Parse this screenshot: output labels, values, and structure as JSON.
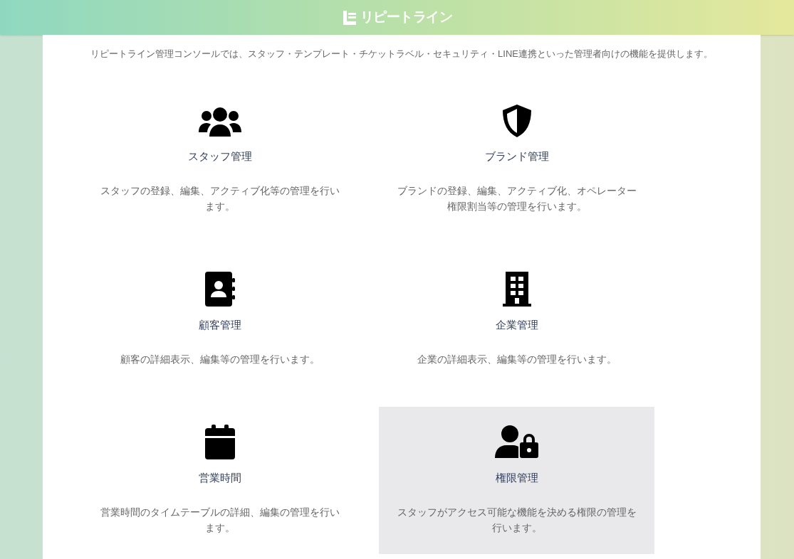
{
  "header": {
    "logo_text": "リピートライン"
  },
  "intro": "リピートライン管理コンソールでは、スタッフ・テンプレート・チケットラベル・セキュリティ・LINE連携といった管理者向けの機能を提供します。",
  "cards": [
    {
      "kind": "users",
      "title": "スタッフ管理",
      "description": "スタッフの登録、編集、アクティブ化等の管理を行います。",
      "selected": false
    },
    {
      "kind": "shield",
      "title": "ブランド管理",
      "description": "ブランドの登録、編集、アクティブ化、オペレーター権限割当等の管理を行います。",
      "selected": false
    },
    {
      "kind": "contact",
      "title": "顧客管理",
      "description": "顧客の詳細表示、編集等の管理を行います。",
      "selected": false
    },
    {
      "kind": "building",
      "title": "企業管理",
      "description": "企業の詳細表示、編集等の管理を行います。",
      "selected": false
    },
    {
      "kind": "calendar",
      "title": "営業時間",
      "description": "営業時間のタイムテーブルの詳細、編集の管理を行います。",
      "selected": false
    },
    {
      "kind": "user-lock",
      "title": "権限管理",
      "description": "スタッフがアクセス可能な機能を決める権限の管理を行います。",
      "selected": true
    }
  ]
}
